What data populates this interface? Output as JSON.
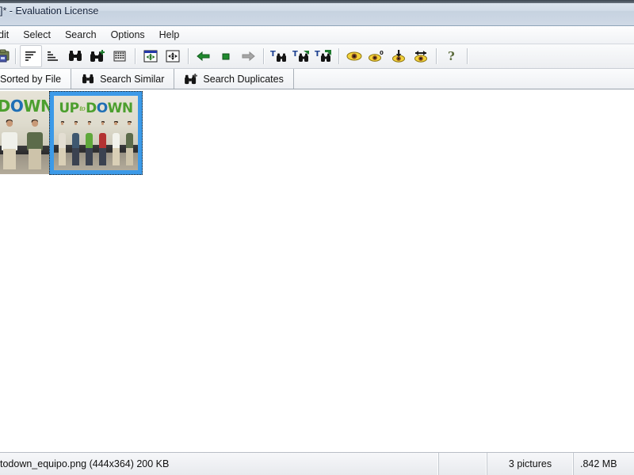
{
  "window": {
    "title": "]* - Evaluation License"
  },
  "menubar": {
    "items": [
      {
        "label": "dit"
      },
      {
        "label": "Select"
      },
      {
        "label": "Search"
      },
      {
        "label": "Options"
      },
      {
        "label": "Help"
      }
    ]
  },
  "toolbar": {
    "buttons": [
      {
        "name": "save-briefcase-icon",
        "tooltip": "Save"
      },
      {
        "name": "sort-descending-icon",
        "tooltip": "Sort descending"
      },
      {
        "name": "sort-ascending-icon",
        "tooltip": "Sort ascending"
      },
      {
        "name": "binoculars-icon",
        "tooltip": "Search"
      },
      {
        "name": "binoculars-plus-icon",
        "tooltip": "Search more"
      },
      {
        "name": "grid-icon",
        "tooltip": "Grid view"
      },
      {
        "name": "fit-image-icon",
        "tooltip": "Fit image"
      },
      {
        "name": "fit-window-icon",
        "tooltip": "Fit window"
      },
      {
        "name": "back-arrow-icon",
        "tooltip": "Back"
      },
      {
        "name": "stop-square-icon",
        "tooltip": "Stop"
      },
      {
        "name": "forward-arrow-icon",
        "tooltip": "Forward"
      },
      {
        "name": "text-search-icon",
        "tooltip": "Text search"
      },
      {
        "name": "text-search-next-icon",
        "tooltip": "Text search next"
      },
      {
        "name": "text-search-all-icon",
        "tooltip": "Text search all"
      },
      {
        "name": "eye-icon",
        "tooltip": "View"
      },
      {
        "name": "eye-zero-icon",
        "tooltip": "Reset views"
      },
      {
        "name": "eye-down-icon",
        "tooltip": "View down"
      },
      {
        "name": "eye-swap-icon",
        "tooltip": "Swap view"
      },
      {
        "name": "help-question-icon",
        "tooltip": "Help"
      }
    ]
  },
  "tabs": [
    {
      "label": "Sorted by File",
      "icon": "none",
      "active": true
    },
    {
      "label": "Search Similar",
      "icon": "binoculars-icon",
      "active": false
    },
    {
      "label": "Search Duplicates",
      "icon": "binoculars-plus-icon",
      "active": false
    }
  ],
  "thumbnails": [
    {
      "name": "thumbnail-1",
      "selected": false,
      "partial": true,
      "caption_text": "UP to DOWN"
    },
    {
      "name": "thumbnail-2",
      "selected": true,
      "partial": false,
      "caption_text": "UP to DOWN"
    }
  ],
  "statusbar": {
    "file": "todown_equipo.png (444x364) 200 KB",
    "count": "3 pictures",
    "size": ".842 MB"
  },
  "colors": {
    "selection_blue": "#3c9ae8",
    "title_text": "#11203a",
    "content_bg": "#ffffff"
  }
}
